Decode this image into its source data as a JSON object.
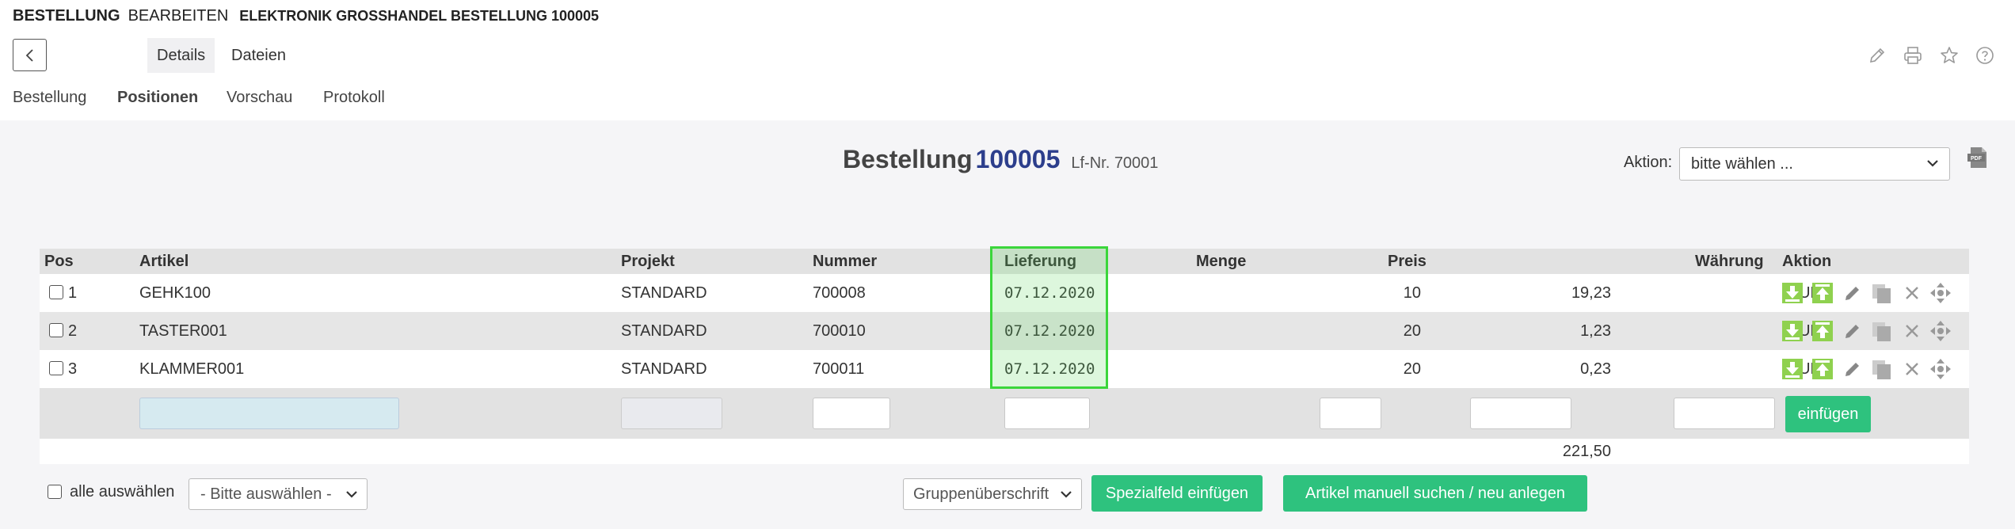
{
  "breadcrumb": {
    "section": "BESTELLUNG",
    "mode": "BEARBEITEN",
    "record": "ELEKTRONIK GROSSHANDEL BESTELLUNG 100005"
  },
  "tabs": [
    {
      "label": "Details",
      "active": true
    },
    {
      "label": "Dateien",
      "active": false
    }
  ],
  "header_icons": [
    "pencil-icon",
    "print-icon",
    "star-icon",
    "help-icon"
  ],
  "subnav": [
    {
      "label": "Bestellung",
      "active": false
    },
    {
      "label": "Positionen",
      "active": true
    },
    {
      "label": "Vorschau",
      "active": false
    },
    {
      "label": "Protokoll",
      "active": false
    }
  ],
  "title": {
    "prefix": "Bestellung",
    "number": "100005",
    "supplier_no": "Lf-Nr. 70001"
  },
  "aktion": {
    "label": "Aktion:",
    "selected": "bitte wählen ..."
  },
  "table": {
    "columns": [
      "Pos",
      "Artikel",
      "Projekt",
      "Nummer",
      "Lieferung",
      "Menge",
      "Preis",
      "Währung",
      "Aktion"
    ],
    "rows": [
      {
        "pos": "1",
        "artikel": "GEHK100",
        "projekt": "STANDARD",
        "nummer": "700008",
        "lieferung": "07.12.2020",
        "menge": "10",
        "preis": "19,23",
        "waehrung": "EUR"
      },
      {
        "pos": "2",
        "artikel": "TASTER001",
        "projekt": "STANDARD",
        "nummer": "700010",
        "lieferung": "07.12.2020",
        "menge": "20",
        "preis": "1,23",
        "waehrung": "EUR"
      },
      {
        "pos": "3",
        "artikel": "KLAMMER001",
        "projekt": "STANDARD",
        "nummer": "700011",
        "lieferung": "07.12.2020",
        "menge": "20",
        "preis": "0,23",
        "waehrung": "EUR"
      }
    ],
    "insert_button": "einfügen",
    "total": "221,50"
  },
  "highlight_color": "#3bd63b",
  "accent_green": "#2ec27e",
  "bottom": {
    "select_all_label": "alle auswählen",
    "bulk_select": "- Bitte auswählen -",
    "group_select": "Gruppenüberschrift",
    "special_field_button": "Spezialfeld einfügen",
    "manual_article_button": "Artikel manuell suchen / neu anlegen"
  }
}
